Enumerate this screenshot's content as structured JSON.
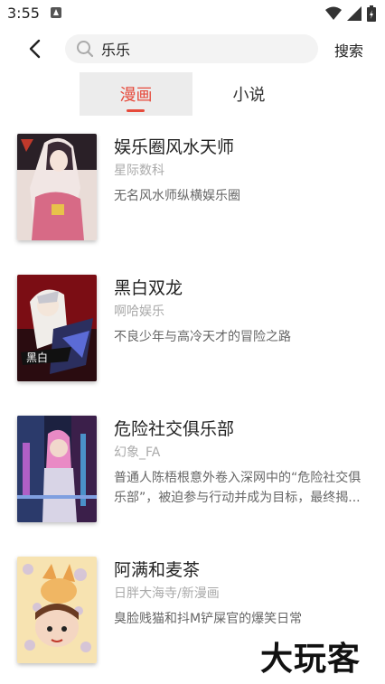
{
  "status": {
    "time": "3:55"
  },
  "header": {
    "search_value": "乐乐",
    "search_placeholder": "",
    "search_button": "搜索"
  },
  "tabs": [
    {
      "label": "漫画",
      "active": true
    },
    {
      "label": "小说",
      "active": false
    }
  ],
  "results": [
    {
      "title": "娱乐圈风水天师",
      "author": "星际数科",
      "desc": "无名风水师纵横娱乐圈"
    },
    {
      "title": "黑白双龙",
      "author": "啊哈娱乐",
      "desc": "不良少年与高冷天才的冒险之路"
    },
    {
      "title": "危险社交俱乐部",
      "author": "幻象_FA",
      "desc": "普通人陈梧根意外卷入深网中的“危险社交俱乐部”，被迫参与行动并成为目标，最终揭..."
    },
    {
      "title": "阿满和麦茶",
      "author": "日胖大海寺/新漫画",
      "desc": "臭脸贱猫和抖M铲屎官的爆笑日常"
    }
  ],
  "watermark": "大玩客",
  "colors": {
    "accent": "#e64a3b"
  }
}
